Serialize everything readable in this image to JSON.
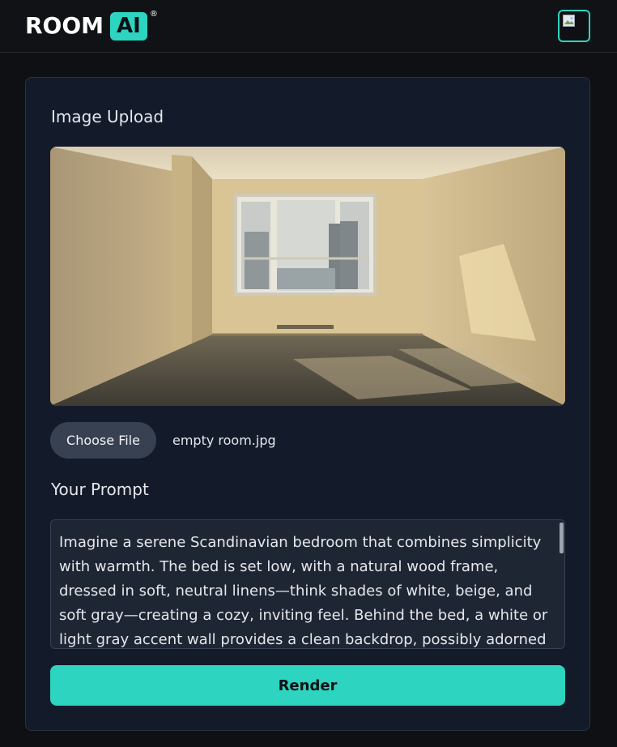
{
  "header": {
    "logo_text": "ROOM",
    "logo_badge": "AI",
    "logo_mark": "®",
    "avatar_icon": "broken-image-icon"
  },
  "upload": {
    "title": "Image Upload",
    "choose_file_label": "Choose File",
    "file_name": "empty room.jpg"
  },
  "prompt": {
    "title": "Your Prompt",
    "value": "Imagine a serene Scandinavian bedroom that combines simplicity with warmth. The bed is set low, with a natural wood frame, dressed in soft, neutral linens—think shades of white, beige, and soft gray—creating a cozy, inviting feel. Behind the bed, a white or light gray accent wall provides a clean backdrop, possibly adorned with a small"
  },
  "actions": {
    "render_label": "Render"
  },
  "colors": {
    "accent": "#2dd4bf",
    "background": "#0f1014",
    "card": "#131a2a",
    "button_secondary": "#374151"
  }
}
